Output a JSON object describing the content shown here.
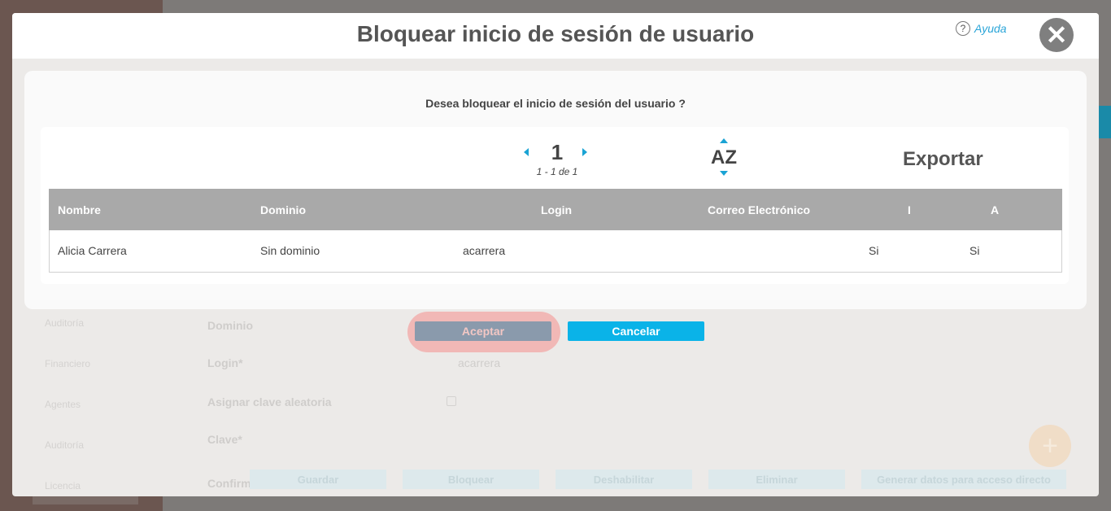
{
  "modal": {
    "title": "Bloquear inicio de sesión de usuario",
    "help_label": "Ayuda",
    "help_icon": "?",
    "close_icon": "✕"
  },
  "confirm": {
    "question": "Desea bloquear el inicio de sesión del usuario ?",
    "pager": {
      "page": "1",
      "range": "1 - 1 de 1"
    },
    "sort_label": "AZ",
    "export_label": "Exportar",
    "table": {
      "headers": [
        "Nombre",
        "Dominio",
        "Login",
        "Correo Electrónico",
        "I",
        "A"
      ],
      "rows": [
        [
          "Alicia Carrera",
          "Sin dominio",
          "acarrera",
          "",
          "Si",
          "Si"
        ]
      ]
    }
  },
  "actions": {
    "accept_label": "Aceptar",
    "cancel_label": "Cancelar"
  },
  "background_form": {
    "labels": [
      "Dominio",
      "Login*",
      "Asignar clave aleatoria",
      "Clave*",
      "Confirm"
    ],
    "login_value": "acarrera",
    "buttons": [
      "Guardar",
      "Bloquear",
      "Deshabilitar",
      "Eliminar",
      "Generar datos para acceso directo"
    ],
    "side_items": [
      "Auditoría",
      "Financiero",
      "Agentes",
      "Auditoría",
      "Licencia"
    ]
  },
  "colors": {
    "accent": "#0ab3e8",
    "header_gray": "#a9a9a9",
    "accept_bg": "#8a9aac",
    "accept_highlight": "#f1b8b6"
  }
}
